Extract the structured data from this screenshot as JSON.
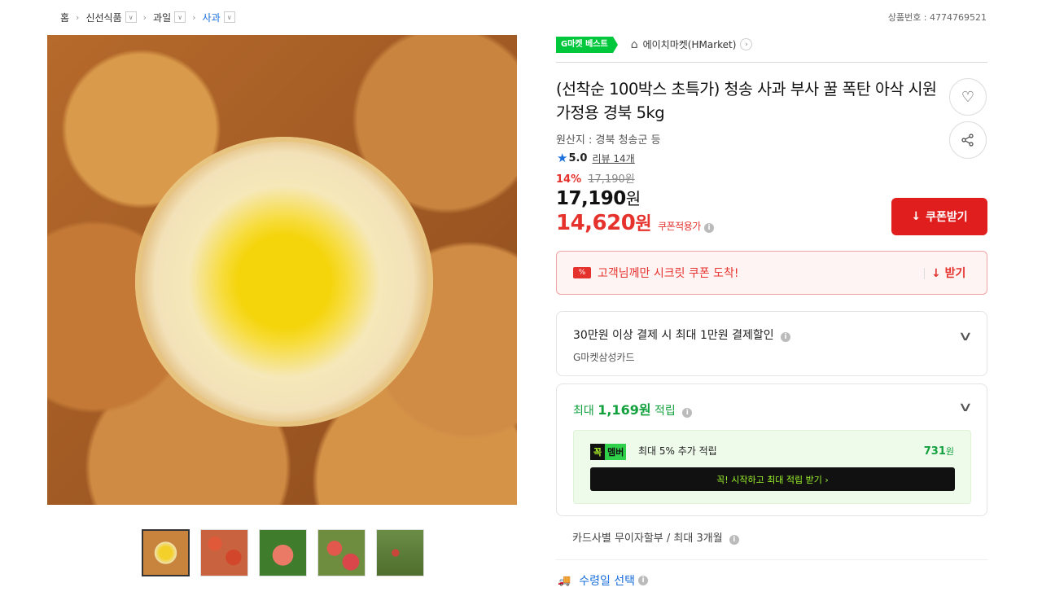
{
  "breadcrumb": {
    "home": "홈",
    "level1": "신선식품",
    "level2": "과일",
    "level3": "사과"
  },
  "product_number": "상품번호 : 4774769521",
  "badge": "G마켓 베스트",
  "store": {
    "name": "에이치마켓(HMarket)"
  },
  "title": "(선착순 100박스 초특가) 청송 사과 부사 꿀 폭탄 아삭 시원 가정용 경북 5kg",
  "origin": "원산지 : 경북 청송군 등",
  "rating": {
    "score": "5.0",
    "reviews": "리뷰 14개"
  },
  "discount": {
    "percent": "14%",
    "original": "17,190원"
  },
  "price": {
    "amount": "17,190",
    "unit": "원"
  },
  "coupon_price": {
    "amount": "14,620",
    "unit": "원",
    "label": "쿠폰적용가"
  },
  "coupon_button": "쿠폰받기",
  "secret_coupon": {
    "tag": "%",
    "text": "고객님께만 시크릿 쿠폰 도착!",
    "action": "받기"
  },
  "card_discount": {
    "title": "30만원 이상 결제 시 최대 1만원 결제할인",
    "sub": "G마켓삼성카드"
  },
  "points": {
    "prefix": "최대 ",
    "amount": "1,169원",
    "suffix": " 적립",
    "member_k": "꼭",
    "member_label": "멤버",
    "member_text": "최대 5% 추가 적립",
    "member_amount": "731",
    "member_unit": "원",
    "start_button": "꼭! 시작하고 최대 적립 받기  ›"
  },
  "installment": "카드사별 무이자할부 / 최대 3개월",
  "delivery": "수령일 선택",
  "colors": {
    "accent_red": "#e5322d",
    "green": "#12a13d",
    "blue": "#1a6fdb"
  }
}
